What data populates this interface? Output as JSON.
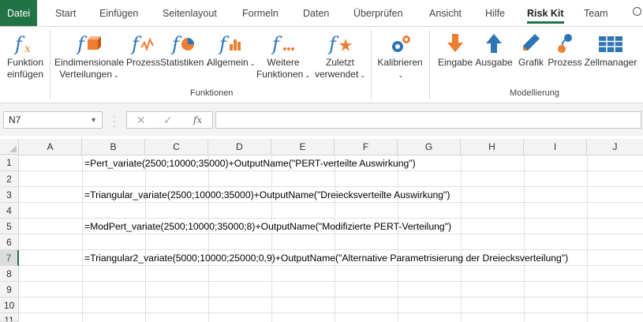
{
  "tabs": [
    "Datei",
    "Start",
    "Einfügen",
    "Seitenlayout",
    "Formeln",
    "Daten",
    "Überprüfen",
    "Ansicht",
    "Hilfe",
    "Risk Kit",
    "Team"
  ],
  "ribbon": {
    "funktion_einfuegen": [
      "Funktion",
      "einfügen"
    ],
    "eindimensionale": [
      "Eindimensionale",
      "Verteilungen"
    ],
    "prozess": "Prozess",
    "statistiken": "Statistiken",
    "allgemein": "Allgemein",
    "weitere": [
      "Weitere",
      "Funktionen"
    ],
    "zuletzt": [
      "Zuletzt",
      "verwendet"
    ],
    "kalibrieren": "Kalibrieren",
    "eingabe": "Eingabe",
    "ausgabe": "Ausgabe",
    "grafik": "Grafik",
    "prozess2": "Prozess",
    "zellmanager": "Zellmanager",
    "group_funktionen": "Funktionen",
    "group_modellierung": "Modellierung"
  },
  "formula_bar": {
    "name_box": "N7",
    "fx": "fx",
    "value": ""
  },
  "columns": [
    "A",
    "B",
    "C",
    "D",
    "E",
    "F",
    "G",
    "H",
    "I",
    "J"
  ],
  "rows": [
    "1",
    "2",
    "3",
    "4",
    "5",
    "6",
    "7",
    "8",
    "9",
    "10",
    "11"
  ],
  "selected_row": "7",
  "cells": {
    "b1": "=Pert_variate(2500;10000;35000)+OutputName(\"PERT-verteilte Auswirkung\")",
    "b3": "=Triangular_variate(2500;10000;35000)+OutputName(\"Dreiecksverteilte Auswirkung\")",
    "b5": "=ModPert_variate(2500;10000;35000;8)+OutputName(\"Modifizierte PERT-Verteilung\")",
    "b7": "=Triangular2_variate(5000;10000;25000;0,9)+OutputName(\"Alternative Parametrisierung der Dreiecksverteilung\")"
  },
  "colors": {
    "excel_green": "#217346",
    "icon_blue": "#2e75b6",
    "icon_orange": "#ed7d31"
  },
  "icons": [
    "fx-icon",
    "cube-fx-icon",
    "process-fx-icon",
    "pie-fx-icon",
    "bar-fx-icon",
    "fx-dots-icon",
    "fx-star-icon",
    "gears-icon",
    "arrow-down-icon",
    "arrow-up-icon",
    "pencil-icon",
    "process-icon",
    "grid-icon"
  ]
}
